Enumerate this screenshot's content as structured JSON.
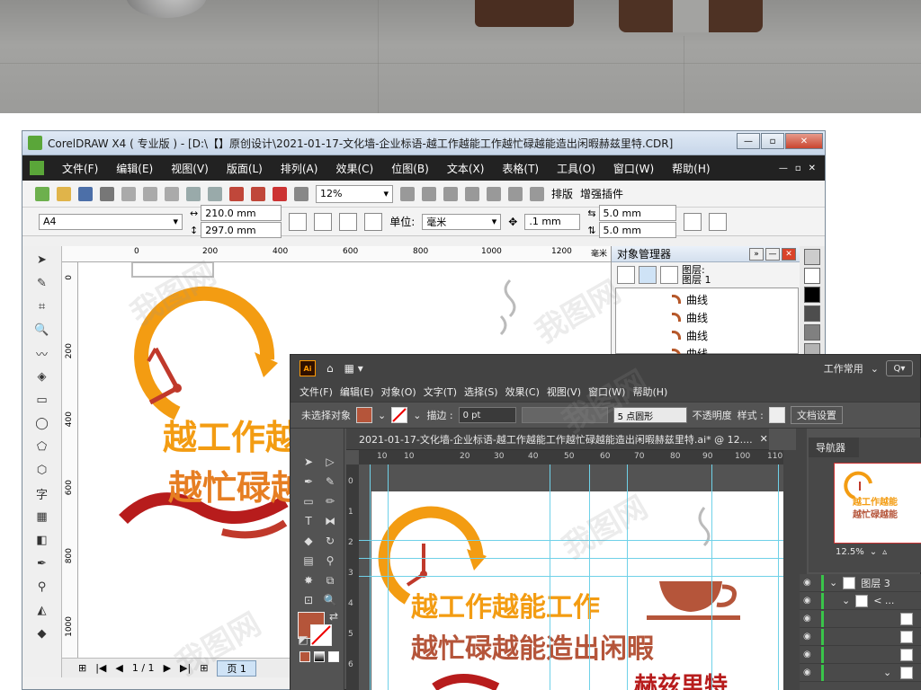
{
  "corel": {
    "title": "CorelDRAW X4 ( 专业版 ) - [D:\\【】原创设计\\2021-01-17-文化墙-企业标语-越工作越能工作越忙碌越能造出闲暇赫兹里特.CDR]",
    "menu": [
      "文件(F)",
      "编辑(E)",
      "视图(V)",
      "版面(L)",
      "排列(A)",
      "效果(C)",
      "位图(B)",
      "文本(X)",
      "表格(T)",
      "工具(O)",
      "窗口(W)",
      "帮助(H)"
    ],
    "zoom": "12%",
    "toolbar_labels": {
      "arrange": "排版",
      "plugin": "增强插件"
    },
    "paper": "A4",
    "width": "210.0 mm",
    "height": "297.0 mm",
    "unit_label": "单位:",
    "unit_value": "毫米",
    "nudge": ".1 mm",
    "dup_x": "5.0 mm",
    "dup_y": "5.0 mm",
    "ruler_top": [
      "0",
      "200",
      "400",
      "600",
      "800",
      "1000",
      "1200",
      "毫米"
    ],
    "ruler_left": [
      "0",
      "200",
      "400",
      "600",
      "800",
      "1000"
    ],
    "status": {
      "page_counter": "1 / 1",
      "page_tab": "页 1"
    },
    "object_manager": {
      "title": "对象管理器",
      "layer_info": [
        "图层:",
        "图层 1"
      ],
      "items": [
        "曲线",
        "曲线",
        "曲线",
        "曲线"
      ]
    },
    "canvas_text": {
      "line1": "越工作越",
      "line2": "越忙碌越"
    },
    "palette": [
      "#ffffff",
      "#000000",
      "#4d4d4d",
      "#808080",
      "#b3b3b3",
      "#cccccc",
      "#e6e6e6",
      "#ffffff"
    ]
  },
  "illustrator": {
    "logo": "Ai",
    "workspace": "工作常用",
    "menu": [
      "文件(F)",
      "编辑(E)",
      "对象(O)",
      "文字(T)",
      "选择(S)",
      "效果(C)",
      "视图(V)",
      "窗口(W)",
      "帮助(H)"
    ],
    "control": {
      "no_selection": "未选择对象",
      "stroke_label": "描边 :",
      "stroke_value": "0 pt",
      "brush": "5 点圆形",
      "opacity_label": "不透明度",
      "style_label": "样式 :",
      "doc_setup": "文档设置"
    },
    "doc_tab": "2021-01-17-文化墙-企业标语-越工作越能工作越忙碌越能造出闲暇赫兹里特.ai* @ 12....",
    "ruler_top": [
      "10",
      "10",
      "20",
      "30",
      "40",
      "50",
      "60",
      "70",
      "80",
      "90",
      "100",
      "110",
      "120"
    ],
    "ruler_left": [
      "0",
      "1",
      "2",
      "3",
      "4",
      "5",
      "6",
      "7"
    ],
    "artboard_text": {
      "line1": "越工作越能工作",
      "line2": "越忙碌越能造出闲暇",
      "line3": "赫兹里特"
    },
    "navigator": {
      "tab": "导航器",
      "zoom": "12.5%",
      "thumb_line1": "越工作越能",
      "thumb_line2": "越忙碌越能"
    },
    "layers": {
      "layer_name": "图层 3",
      "sublayer": "< ..."
    },
    "colors": {
      "fill": "#b5553a",
      "accent": "#ff9a00"
    }
  },
  "watermark": "我图网"
}
